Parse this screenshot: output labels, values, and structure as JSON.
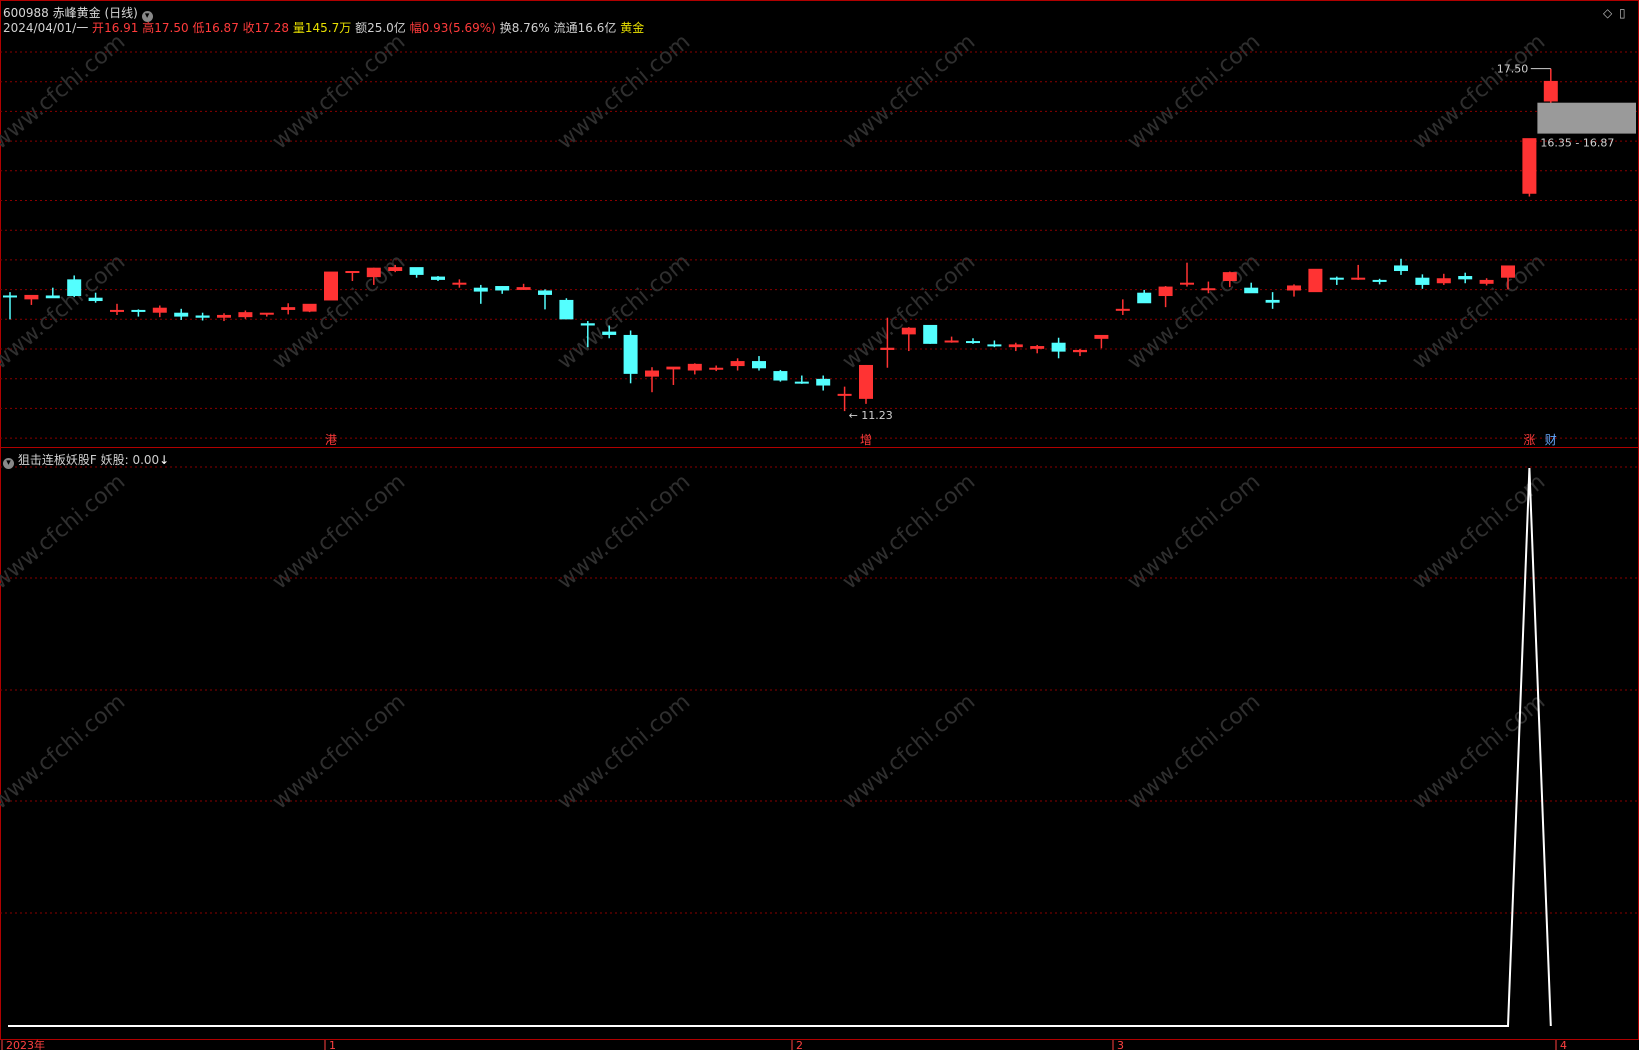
{
  "header": {
    "code": "600988",
    "name": "赤峰黄金",
    "period": "(日线)",
    "date": "2024/04/01/一",
    "open_label": "开",
    "open": "16.91",
    "high_label": "高",
    "high": "17.50",
    "low_label": "低",
    "low": "16.87",
    "close_label": "收",
    "close": "17.28",
    "volume_label": "量",
    "volume": "145.7万",
    "amount_label": "额",
    "amount": "25.0亿",
    "change_label": "幅",
    "change": "0.93(5.69%)",
    "turnover_label": "换",
    "turnover": "8.76%",
    "float_label": "流通",
    "float": "16.6亿",
    "sector": "黄金"
  },
  "top_right_icons": [
    "diamond-icon",
    "maximize-icon"
  ],
  "indicator": {
    "name": "狙击连板妖股F",
    "line_label": "妖股:",
    "value": "0.00",
    "arrow": "↓"
  },
  "annotations": {
    "high_price": "17.50",
    "low_price": "11.23",
    "range_box": "16.35 - 16.87",
    "markers": [
      {
        "text": "港",
        "color": "#ff3b3b"
      },
      {
        "text": "增",
        "color": "#ff3b3b"
      },
      {
        "text": "涨",
        "color": "#ff3b3b"
      },
      {
        "text": "财",
        "color": "#66aaff"
      }
    ]
  },
  "time_axis": [
    "2023年",
    "1",
    "2",
    "3",
    "4"
  ],
  "watermark": "www.cfchi.com",
  "colors": {
    "up": "#ff3333",
    "down": "#54ffff",
    "grid": "#8a0000",
    "line": "#ffffff"
  },
  "chart_data": {
    "type": "candlestick",
    "fields": [
      "open",
      "high",
      "low",
      "close"
    ],
    "ylim": [
      11.0,
      17.8
    ],
    "candles": [
      [
        13.42,
        13.48,
        12.99,
        13.4
      ],
      [
        13.35,
        13.42,
        13.25,
        13.43
      ],
      [
        13.42,
        13.56,
        13.38,
        13.37
      ],
      [
        13.71,
        13.78,
        13.39,
        13.41
      ],
      [
        13.38,
        13.47,
        13.29,
        13.32
      ],
      [
        13.15,
        13.27,
        13.07,
        13.16
      ],
      [
        13.16,
        13.17,
        13.04,
        13.13
      ],
      [
        13.11,
        13.24,
        13.03,
        13.2
      ],
      [
        13.11,
        13.18,
        12.98,
        13.04
      ],
      [
        13.06,
        13.11,
        12.97,
        13.02
      ],
      [
        13.02,
        13.1,
        12.96,
        13.07
      ],
      [
        13.03,
        13.15,
        13.0,
        13.12
      ],
      [
        13.11,
        13.1,
        13.04,
        13.11
      ],
      [
        13.16,
        13.28,
        13.08,
        13.21
      ],
      [
        13.13,
        13.26,
        13.12,
        13.27
      ],
      [
        13.33,
        13.83,
        13.34,
        13.85
      ],
      [
        13.84,
        13.85,
        13.68,
        13.86
      ],
      [
        13.75,
        13.92,
        13.61,
        13.92
      ],
      [
        13.86,
        13.97,
        13.84,
        13.93
      ],
      [
        13.93,
        13.91,
        13.74,
        13.79
      ],
      [
        13.76,
        13.77,
        13.68,
        13.7
      ],
      [
        13.64,
        13.71,
        13.56,
        13.65
      ],
      [
        13.56,
        13.61,
        13.27,
        13.49
      ],
      [
        13.59,
        13.59,
        13.45,
        13.51
      ],
      [
        13.52,
        13.63,
        13.52,
        13.57
      ],
      [
        13.51,
        13.53,
        13.17,
        13.43
      ],
      [
        13.34,
        13.37,
        13.03,
        12.99
      ],
      [
        12.92,
        12.96,
        12.49,
        12.88
      ],
      [
        12.77,
        12.88,
        12.65,
        12.71
      ],
      [
        12.71,
        12.79,
        11.84,
        12.01
      ],
      [
        11.96,
        12.13,
        11.68,
        12.07
      ],
      [
        12.09,
        12.11,
        11.81,
        12.14
      ],
      [
        12.07,
        12.2,
        12.0,
        12.19
      ],
      [
        12.12,
        12.16,
        12.06,
        12.12
      ],
      [
        12.15,
        12.29,
        12.07,
        12.24
      ],
      [
        12.24,
        12.33,
        12.07,
        12.11
      ],
      [
        12.06,
        12.08,
        11.87,
        11.89
      ],
      [
        11.87,
        11.98,
        11.83,
        11.85
      ],
      [
        11.92,
        11.98,
        11.71,
        11.8
      ],
      [
        11.64,
        11.78,
        11.34,
        11.65
      ],
      [
        11.56,
        12.17,
        11.47,
        12.17
      ],
      [
        12.44,
        13.02,
        12.12,
        12.48
      ],
      [
        12.72,
        12.85,
        12.42,
        12.84
      ],
      [
        12.89,
        12.71,
        12.55,
        12.55
      ],
      [
        12.58,
        12.68,
        12.57,
        12.61
      ],
      [
        12.6,
        12.65,
        12.55,
        12.58
      ],
      [
        12.54,
        12.61,
        12.49,
        12.53
      ],
      [
        12.49,
        12.57,
        12.42,
        12.54
      ],
      [
        12.46,
        12.53,
        12.38,
        12.51
      ],
      [
        12.57,
        12.66,
        12.29,
        12.41
      ],
      [
        12.4,
        12.46,
        12.33,
        12.44
      ],
      [
        12.64,
        12.68,
        12.47,
        12.71
      ],
      [
        13.17,
        13.35,
        13.07,
        13.18
      ],
      [
        13.47,
        13.52,
        13.31,
        13.28
      ],
      [
        13.41,
        13.59,
        13.21,
        13.58
      ],
      [
        13.62,
        14.01,
        13.58,
        13.65
      ],
      [
        13.54,
        13.67,
        13.46,
        13.55
      ],
      [
        13.68,
        13.85,
        13.57,
        13.84
      ],
      [
        13.56,
        13.65,
        13.47,
        13.46
      ],
      [
        13.34,
        13.48,
        13.18,
        13.29
      ],
      [
        13.51,
        13.62,
        13.4,
        13.6
      ],
      [
        13.48,
        13.8,
        13.51,
        13.9
      ],
      [
        13.74,
        13.76,
        13.61,
        13.73
      ],
      [
        13.72,
        13.97,
        13.7,
        13.74
      ],
      [
        13.7,
        13.72,
        13.62,
        13.68
      ],
      [
        13.96,
        14.08,
        13.79,
        13.86
      ],
      [
        13.74,
        13.8,
        13.54,
        13.61
      ],
      [
        13.64,
        13.81,
        13.61,
        13.73
      ],
      [
        13.77,
        13.83,
        13.64,
        13.71
      ],
      [
        13.63,
        13.73,
        13.6,
        13.7
      ],
      [
        13.74,
        13.9,
        13.53,
        13.96
      ],
      [
        15.25,
        15.97,
        15.2,
        16.25
      ],
      [
        16.91,
        17.5,
        16.87,
        17.28
      ]
    ],
    "indicator_series": {
      "name": "妖股",
      "values": [
        0,
        0,
        0,
        0,
        0,
        0,
        0,
        0,
        0,
        0,
        0,
        0,
        0,
        0,
        0,
        0,
        0,
        0,
        0,
        0,
        0,
        0,
        0,
        0,
        0,
        0,
        0,
        0,
        0,
        0,
        0,
        0,
        0,
        0,
        0,
        0,
        0,
        0,
        0,
        0,
        0,
        0,
        0,
        0,
        0,
        0,
        0,
        0,
        0,
        0,
        0,
        0,
        0,
        0,
        0,
        0,
        0,
        0,
        0,
        0,
        0,
        0,
        0,
        0,
        0,
        0,
        0,
        0,
        0,
        0,
        0,
        1,
        0
      ]
    }
  }
}
